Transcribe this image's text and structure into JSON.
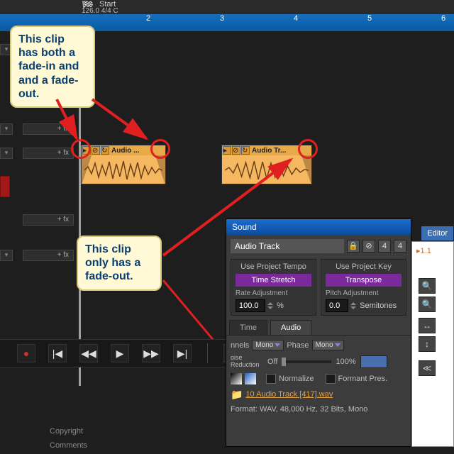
{
  "topbar": {
    "start_label": "Start",
    "tempo": "126.0 4/4 C"
  },
  "timeline": {
    "ticks": [
      "2",
      "3",
      "4",
      "5",
      "6"
    ]
  },
  "tracks": {
    "fx_label": "+ fx"
  },
  "clips": {
    "a": {
      "label": "Audio ..."
    },
    "b": {
      "label": "Audio Tr..."
    }
  },
  "callouts": {
    "left": "This clip has both a fade-in and and a fade-out.",
    "right": "This clip only has a fade-out."
  },
  "sound": {
    "title": "Sound",
    "name": "Audio Track",
    "val4a": "4",
    "val4b": "4",
    "tempo_hdr": "Use Project Tempo",
    "stretch_btn": "Time Stretch",
    "rate_lbl": "Rate Adjustment",
    "rate_val": "100.0",
    "rate_unit": "%",
    "key_hdr": "Use Project Key",
    "transpose_btn": "Transpose",
    "pitch_lbl": "Pitch Adjustment",
    "pitch_val": "0.0",
    "pitch_unit": "Semitones",
    "tab_time": "Time",
    "tab_audio": "Audio",
    "channels_lbl": "nnels",
    "channels_val": "Mono",
    "phase_lbl": "Phase",
    "phase_val": "Mono",
    "nr_lbl": "oise\nReduction",
    "nr_off": "Off",
    "nr_100": "100%",
    "normalize": "Normalize",
    "formant": "Formant Pres.",
    "filename": "10 Audio Track [417].wav",
    "format_lbl": "Format:",
    "format_val": "WAV, 48,000 Hz, 32 Bits, Mono"
  },
  "editor": {
    "tab": "Editor",
    "ver": "1.1"
  },
  "bottom": {
    "copyright": "Copyright",
    "comments": "Comments"
  }
}
